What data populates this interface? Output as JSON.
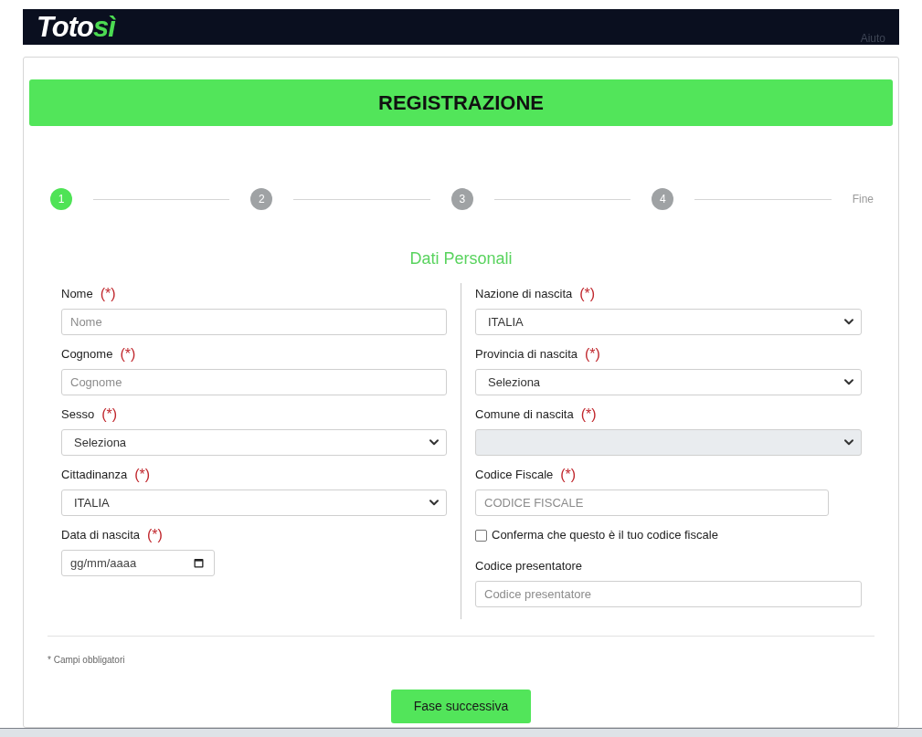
{
  "header": {
    "logo": {
      "text": "Toto",
      "accent": "sì"
    },
    "help_link": "Aiuto"
  },
  "banner": {
    "title": "REGISTRAZIONE"
  },
  "stepper": {
    "steps": [
      {
        "label": "1",
        "selected": true
      },
      {
        "label": "2",
        "selected": false
      },
      {
        "label": "3",
        "selected": false
      },
      {
        "label": "4",
        "selected": false
      }
    ],
    "end_label": "Fine"
  },
  "section_title": "Dati Personali",
  "left_fields": [
    {
      "kind": "text",
      "label": "Nome",
      "required_mark": "(*)",
      "placeholder": "Nome",
      "disabled": false
    },
    {
      "kind": "text",
      "label": "Cognome",
      "required_mark": "(*)",
      "placeholder": "Cognome",
      "disabled": false
    },
    {
      "kind": "select",
      "label": "Sesso",
      "required_mark": "(*)",
      "value": "Seleziona",
      "disabled": false
    },
    {
      "kind": "select",
      "label": "Cittadinanza",
      "required_mark": "(*)",
      "value": "ITALIA",
      "disabled": false
    },
    {
      "kind": "date",
      "label": "Data di nascita",
      "required_mark": "(*)",
      "placeholder": "gg/mm/aaaa",
      "disabled": false
    }
  ],
  "right_fields": [
    {
      "kind": "select",
      "label": "Nazione di nascita",
      "required_mark": "(*)",
      "value": "ITALIA",
      "disabled": false
    },
    {
      "kind": "select",
      "label": "Provincia di nascita",
      "required_mark": "(*)",
      "value": "Seleziona",
      "disabled": false
    },
    {
      "kind": "select",
      "label": "Comune di nascita",
      "required_mark": "(*)",
      "disabled": true
    },
    {
      "kind": "code",
      "label": "Codice Fiscale",
      "required_mark": "(*)",
      "placeholder": "CODICE FISCALE",
      "disabled": false
    },
    {
      "kind": "checkbox",
      "label": "Conferma che questo è il tuo codice fiscale",
      "checked": false,
      "disabled": false
    },
    {
      "kind": "text",
      "label": "Codice presentatore",
      "placeholder": "Codice presentatore",
      "disabled": false
    }
  ],
  "footnote": "* Campi obbligatori",
  "next_button": "Fase successiva"
}
